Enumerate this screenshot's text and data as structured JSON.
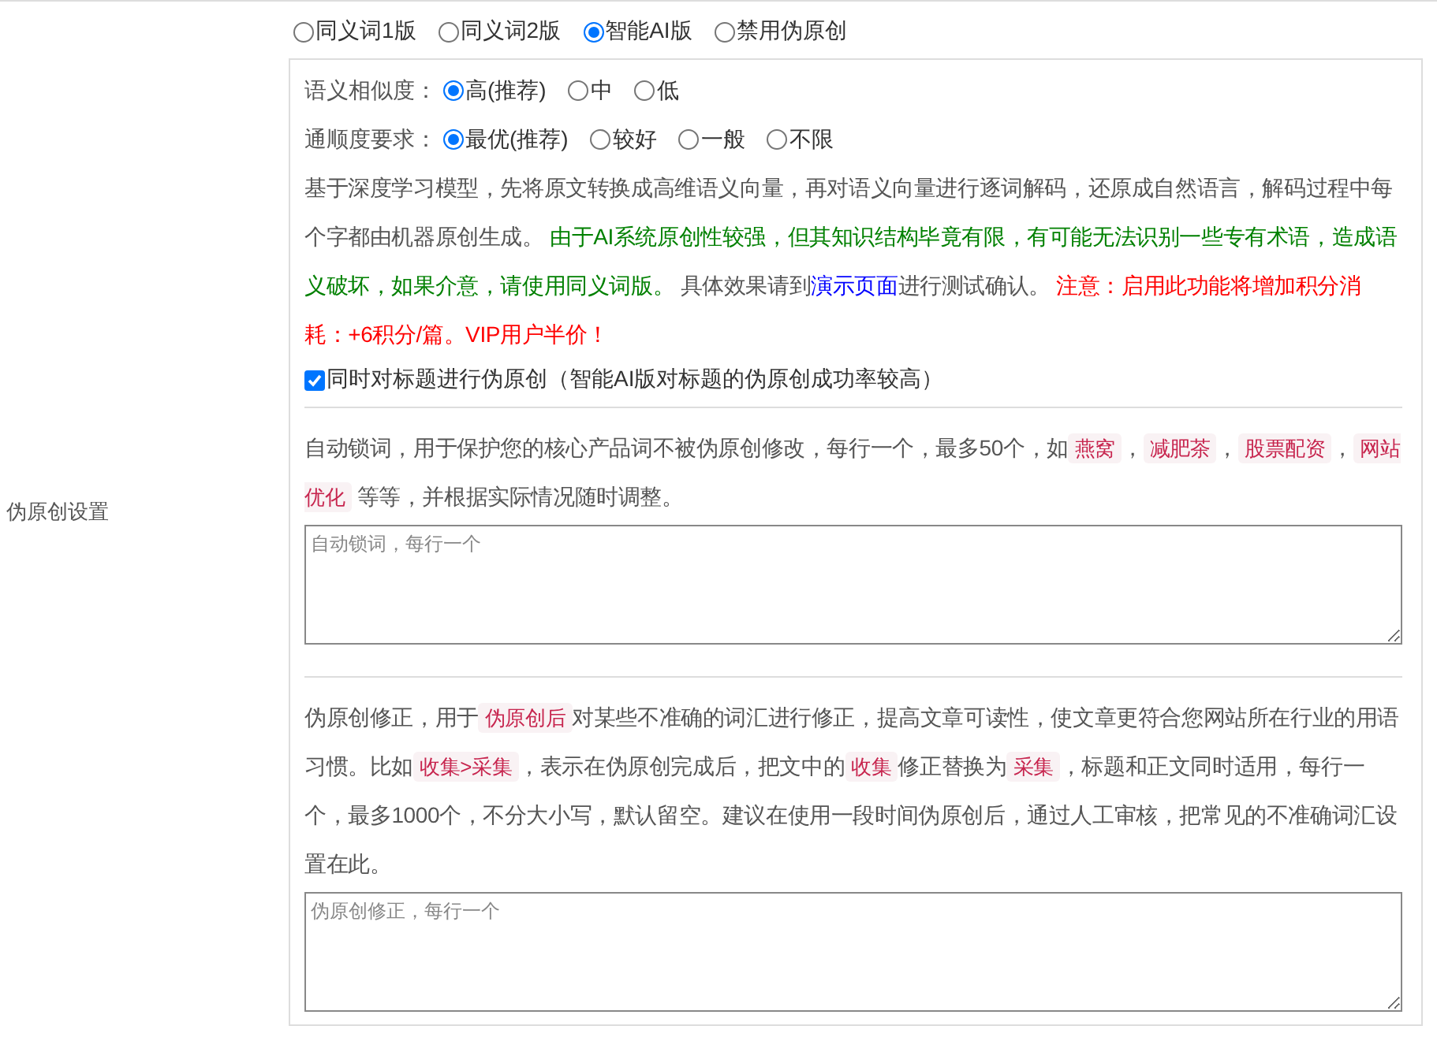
{
  "mode_options": [
    {
      "label": "同义词1版",
      "selected": false
    },
    {
      "label": "同义词2版",
      "selected": false
    },
    {
      "label": "智能AI版",
      "selected": true
    },
    {
      "label": "禁用伪原创",
      "selected": false
    }
  ],
  "ai_settings": {
    "similarity": {
      "label": "语义相似度：",
      "options": [
        {
          "label": "高(推荐)",
          "selected": true
        },
        {
          "label": "中",
          "selected": false
        },
        {
          "label": "低",
          "selected": false
        }
      ]
    },
    "fluency": {
      "label": "通顺度要求：",
      "options": [
        {
          "label": "最优(推荐)",
          "selected": true
        },
        {
          "label": "较好",
          "selected": false
        },
        {
          "label": "一般",
          "selected": false
        },
        {
          "label": "不限",
          "selected": false
        }
      ]
    },
    "description": [
      {
        "kind": "text",
        "text": "基于深度学习模型，先将原文转换成高维语义向量，再对语义向量进行逐词解码，还原成自然语言，解码过程中每个字都由机器原创生成。 "
      },
      {
        "kind": "green",
        "text": "由于AI系统原创性较强，但其知识结构毕竟有限，有可能无法识别一些专有术语，造成语义破坏，如果介意，请使用同义词版。"
      },
      {
        "kind": "text",
        "text": " 具体效果请到"
      },
      {
        "kind": "link",
        "text": "演示页面"
      },
      {
        "kind": "text",
        "text": "进行测试确认。 "
      },
      {
        "kind": "red",
        "text": "注意：启用此功能将增加积分消耗：+6积分/篇。VIP用户半价！"
      }
    ],
    "title_checkbox": {
      "label": "同时对标题进行伪原创（智能AI版对标题的伪原创成功率较高）",
      "checked": true
    }
  },
  "section_label": "伪原创设置",
  "lock_words": {
    "description": [
      {
        "kind": "text",
        "text": "自动锁词，用于保护您的核心产品词不被伪原创修改，每行一个，最多50个，如"
      },
      {
        "kind": "code",
        "text": "燕窝"
      },
      {
        "kind": "text",
        "text": "，"
      },
      {
        "kind": "code",
        "text": "减肥茶"
      },
      {
        "kind": "text",
        "text": "，"
      },
      {
        "kind": "code",
        "text": "股票配资"
      },
      {
        "kind": "text",
        "text": "，"
      },
      {
        "kind": "code",
        "text": "网站优化"
      },
      {
        "kind": "text",
        "text": " 等等，并根据实际情况随时调整。"
      }
    ],
    "placeholder": "自动锁词，每行一个"
  },
  "correction": {
    "description": [
      {
        "kind": "text",
        "text": "伪原创修正，用于"
      },
      {
        "kind": "code",
        "text": "伪原创后"
      },
      {
        "kind": "text",
        "text": "对某些不准确的词汇进行修正，提高文章可读性，使文章更符合您网站所在行业的用语习惯。比如"
      },
      {
        "kind": "code",
        "text": "收集>采集"
      },
      {
        "kind": "text",
        "text": "，表示在伪原创完成后，把文中的"
      },
      {
        "kind": "code",
        "text": "收集"
      },
      {
        "kind": "text",
        "text": "修正替换为"
      },
      {
        "kind": "code",
        "text": "采集"
      },
      {
        "kind": "text",
        "text": "，标题和正文同时适用，每行一个，最多1000个，不分大小写，默认留空。建议在使用一段时间伪原创后，通过人工审核，把常见的不准确词汇设置在此。"
      }
    ],
    "placeholder": "伪原创修正，每行一个"
  }
}
